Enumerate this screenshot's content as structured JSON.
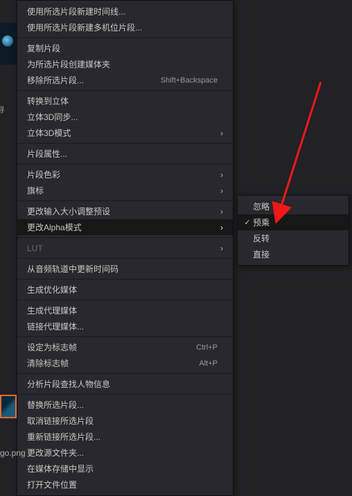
{
  "menu": {
    "groups": [
      [
        {
          "label": "使用所选片段新建时间线...",
          "shortcut": "",
          "arrow": false
        },
        {
          "label": "使用所选片段新建多机位片段...",
          "shortcut": "",
          "arrow": false
        }
      ],
      [
        {
          "label": "复制片段",
          "shortcut": "",
          "arrow": false
        },
        {
          "label": "为所选片段创建媒体夹",
          "shortcut": "",
          "arrow": false
        },
        {
          "label": "移除所选片段...",
          "shortcut": "Shift+Backspace",
          "arrow": false
        }
      ],
      [
        {
          "label": "转换到立体",
          "shortcut": "",
          "arrow": false
        },
        {
          "label": "立体3D同步...",
          "shortcut": "",
          "arrow": false
        },
        {
          "label": "立体3D模式",
          "shortcut": "",
          "arrow": true
        }
      ],
      [
        {
          "label": "片段属性...",
          "shortcut": "",
          "arrow": false
        }
      ],
      [
        {
          "label": "片段色彩",
          "shortcut": "",
          "arrow": true
        },
        {
          "label": "旗标",
          "shortcut": "",
          "arrow": true
        }
      ],
      [
        {
          "label": "更改输入大小调整预设",
          "shortcut": "",
          "arrow": true
        },
        {
          "label": "更改Alpha模式",
          "shortcut": "",
          "arrow": true,
          "highlight": true
        }
      ],
      [
        {
          "label": "LUT",
          "shortcut": "",
          "arrow": true,
          "disabled": true
        }
      ],
      [
        {
          "label": "从音频轨道中更新时间码",
          "shortcut": "",
          "arrow": false
        }
      ],
      [
        {
          "label": "生成优化媒体",
          "shortcut": "",
          "arrow": false
        }
      ],
      [
        {
          "label": "生成代理媒体",
          "shortcut": "",
          "arrow": false
        },
        {
          "label": "链接代理媒体...",
          "shortcut": "",
          "arrow": false
        }
      ],
      [
        {
          "label": "设定为标志帧",
          "shortcut": "Ctrl+P",
          "arrow": false
        },
        {
          "label": "清除标志帧",
          "shortcut": "Alt+P",
          "arrow": false
        }
      ],
      [
        {
          "label": "分析片段查找人物信息",
          "shortcut": "",
          "arrow": false
        }
      ],
      [
        {
          "label": "替换所选片段...",
          "shortcut": "",
          "arrow": false
        },
        {
          "label": "取消链接所选片段",
          "shortcut": "",
          "arrow": false
        },
        {
          "label": "重新链接所选片段...",
          "shortcut": "",
          "arrow": false
        },
        {
          "label": "更改源文件夹...",
          "shortcut": "",
          "arrow": false
        },
        {
          "label": "在媒体存储中显示",
          "shortcut": "",
          "arrow": false
        },
        {
          "label": "打开文件位置",
          "shortcut": "",
          "arrow": false
        }
      ]
    ]
  },
  "submenu": {
    "items": [
      {
        "label": "忽略",
        "checked": false
      },
      {
        "label": "预乘",
        "checked": true,
        "highlight": true
      },
      {
        "label": "反转",
        "checked": false
      },
      {
        "label": "直接",
        "checked": false
      }
    ]
  },
  "sideText": "寻",
  "filename": "go.png",
  "arrowColor": "#f01818"
}
